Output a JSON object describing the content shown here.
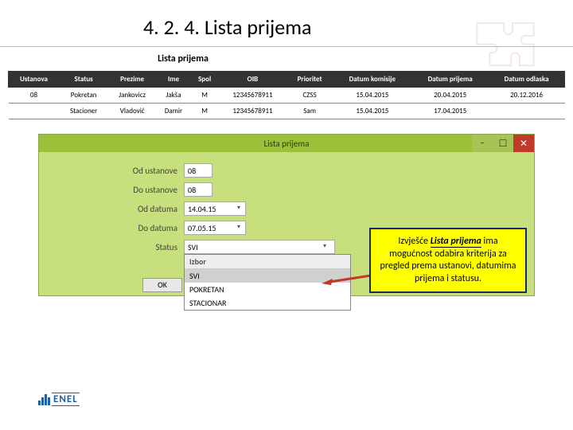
{
  "slide": {
    "title": "4. 2. 4. Lista prijema"
  },
  "report": {
    "title": "Lista prijema",
    "headers": [
      "Ustanova",
      "Status",
      "Prezime",
      "Ime",
      "Spol",
      "OIB",
      "Prioritet",
      "Datum komisije",
      "Datum prijema",
      "Datum odlaska"
    ],
    "rows": [
      [
        "08",
        "Pokretan",
        "Jankovicz",
        "Jakša",
        "M",
        "12345678911",
        "CZSS",
        "15.04.2015",
        "20.04.2015",
        "20.12.2016"
      ],
      [
        "",
        "Stacioner",
        "Vladović",
        "Damir",
        "M",
        "12345678911",
        "Sam",
        "15.04.2015",
        "17.04.2015",
        ""
      ]
    ]
  },
  "dialog": {
    "title": "Lista prijema",
    "fields": {
      "od_ustanove": {
        "label": "Od ustanove",
        "value": "08"
      },
      "do_ustanove": {
        "label": "Do ustanove",
        "value": "08"
      },
      "od_datuma": {
        "label": "Od datuma",
        "value": "14.04.15"
      },
      "do_datuma": {
        "label": "Do datuma",
        "value": "07.05.15"
      },
      "status": {
        "label": "Status",
        "value": "SVI"
      }
    },
    "dropdown": {
      "heading": "Izbor",
      "options": [
        "SVI",
        "POKRETAN",
        "STACIONAR"
      ],
      "selected": "SVI"
    },
    "ok_label": "OK"
  },
  "callout": {
    "pre": "Izvješće ",
    "em": "Lista prijema",
    "post": " ima mogućnost odabira kriterija za pregled prema ustanovi, datumima prijema i statusu."
  },
  "logo": {
    "text": "ENEL"
  }
}
